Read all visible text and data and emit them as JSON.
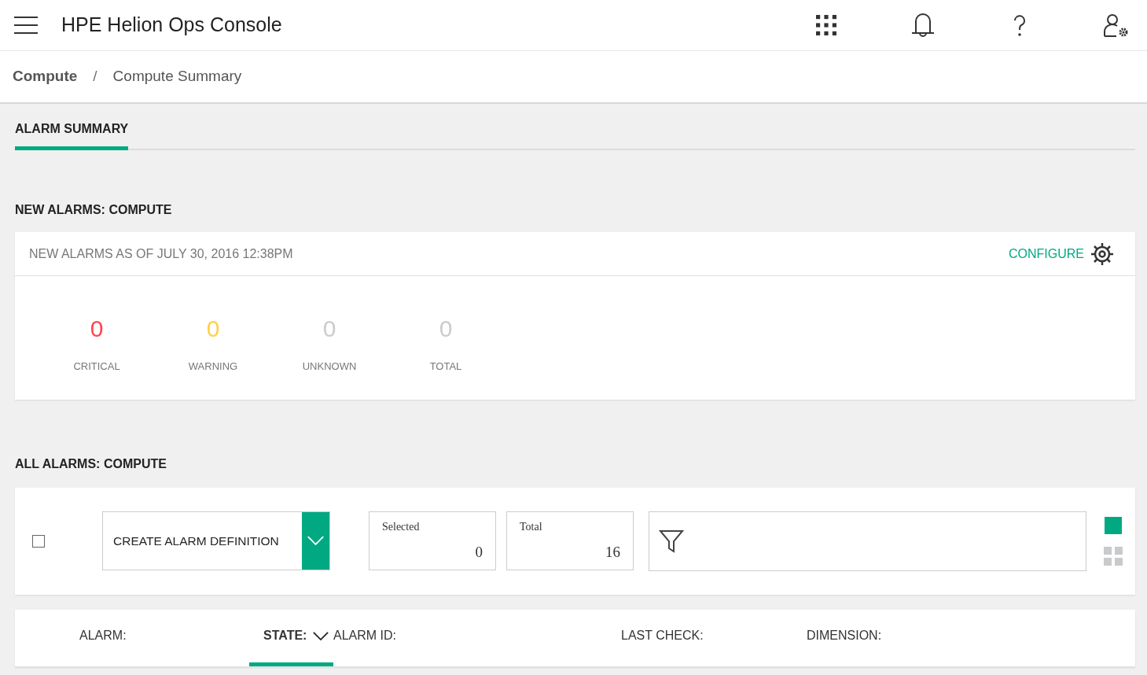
{
  "header": {
    "title": "HPE Helion Ops Console"
  },
  "breadcrumb": [
    {
      "label": "Compute",
      "current": false
    },
    {
      "label": "/",
      "kind": "separator"
    },
    {
      "label": "Compute Summary",
      "current": true
    }
  ],
  "tabs": [
    {
      "label": "ALARM SUMMARY",
      "selected": true
    }
  ],
  "new_alarms": {
    "heading": "NEW ALARMS: COMPUTE",
    "subtitle": "NEW ALARMS AS OF JULY 30, 2016 12:38PM",
    "configure": "CONFIGURE",
    "counts": [
      {
        "value": "0",
        "label": "CRITICAL",
        "color": "#ff454f"
      },
      {
        "value": "0",
        "label": "WARNING",
        "color": "#ffd144"
      },
      {
        "value": "0",
        "label": "UNKNOWN",
        "color": "#cccccc"
      },
      {
        "value": "0",
        "label": "TOTAL",
        "color": "#cccccc"
      }
    ]
  },
  "all_alarms": {
    "heading": "ALL ALARMS: COMPUTE",
    "select_all": {
      "checked": false
    },
    "create_button": "CREATE ALARM DEFINITION",
    "selected_box": {
      "label": "Selected",
      "value": "0"
    },
    "total_box": {
      "label": "Total",
      "value": "16"
    },
    "views": [
      {
        "kind": "single",
        "selected": true
      },
      {
        "kind": "grid",
        "selected": false
      }
    ],
    "columns": [
      {
        "label": "ALARM:",
        "selected": false
      },
      {
        "label": "STATE:",
        "selected": true
      },
      {
        "label": "ALARM ID:",
        "selected": false
      },
      {
        "label": "LAST CHECK:",
        "selected": false
      },
      {
        "label": "DIMENSION:",
        "selected": false
      }
    ]
  }
}
